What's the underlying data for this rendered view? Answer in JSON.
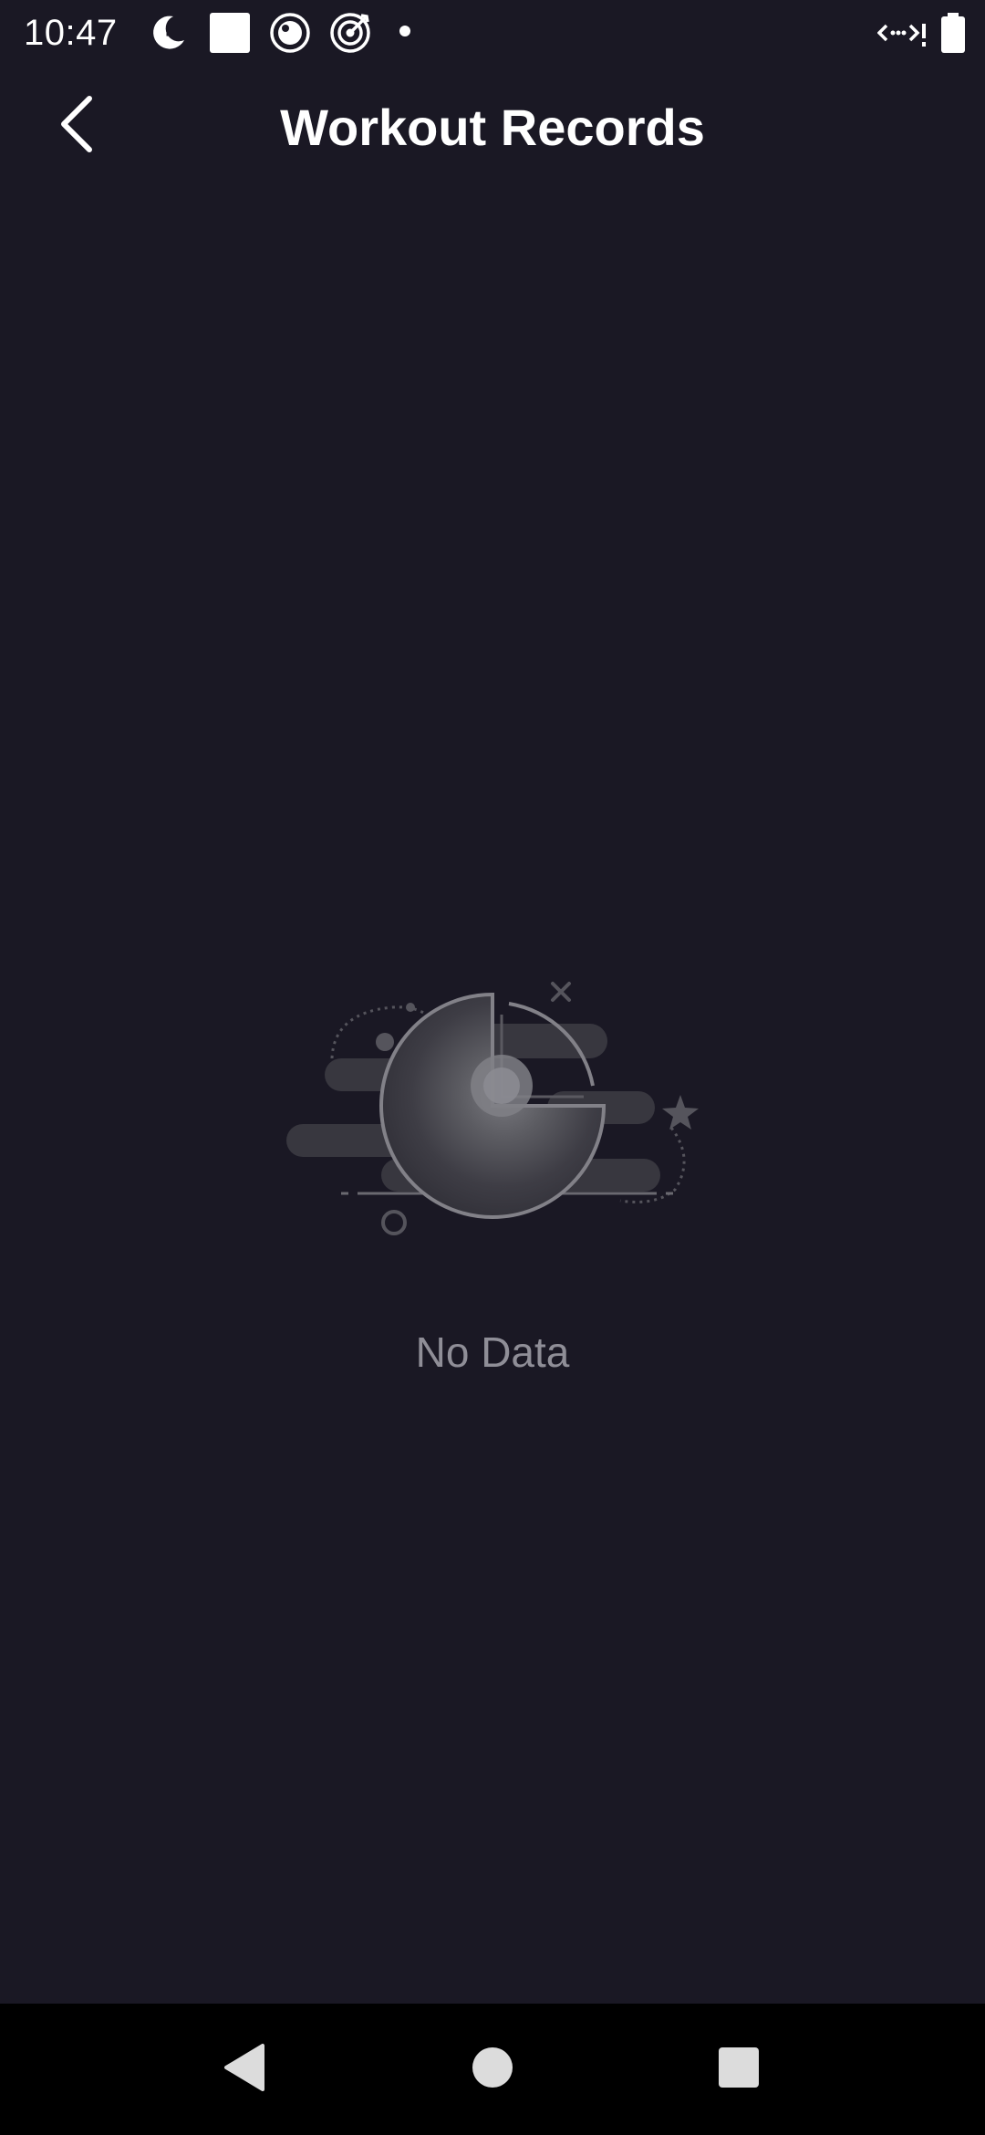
{
  "status_bar": {
    "time": "10:47",
    "left_icons": [
      "do-not-disturb-icon",
      "square-notification-icon",
      "circle-app-icon",
      "target-icon",
      "dot-icon"
    ],
    "right_icons": [
      "data-signal-icon",
      "battery-icon"
    ]
  },
  "header": {
    "title": "Workout Records",
    "back_icon": "chevron-left-icon"
  },
  "empty_state": {
    "illustration_icon": "empty-chart-icon",
    "message": "No Data"
  },
  "nav_bar": {
    "icons": [
      "back-triangle-icon",
      "home-circle-icon",
      "recents-square-icon"
    ]
  },
  "colors": {
    "background": "#1a1824",
    "title": "#ffffff",
    "empty_text": "#8f8e97",
    "nav_background": "#000000"
  }
}
